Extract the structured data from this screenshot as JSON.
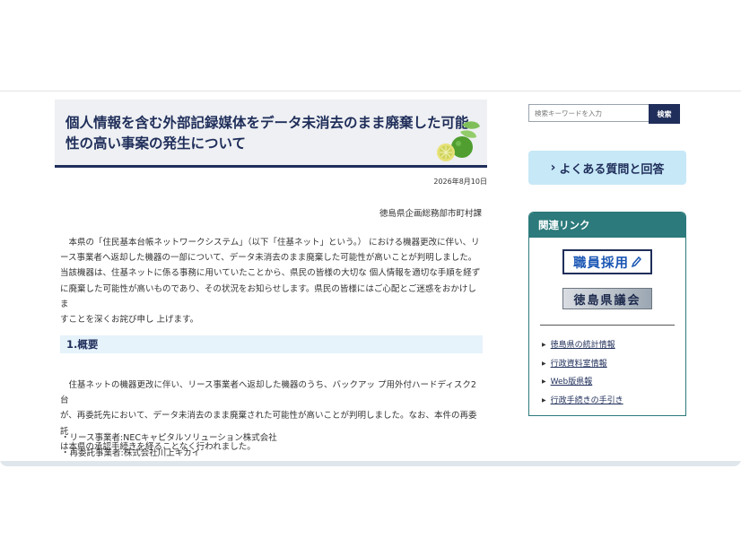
{
  "article": {
    "title": "個人情報を含む外部記録媒体をデータ未消去のまま廃棄した可能性の高い事案の発生について",
    "date": "2026年8月10日",
    "department": "徳島県企画総務部市町村課",
    "intro_lines": [
      "　本県の「住民基本台帳ネットワークシステム」（以下「住基ネット」という。） における機器更改に伴い、リ",
      "ース事業者へ返却した機器の一部について、データ未消去のまま廃棄した可能性が高いことが判明しました。",
      "当該機器は、住基ネットに係る事務に用いていたことから、県民の皆様の大切な 個人情報を適切な手順を経ず",
      "に廃棄した可能性が高いものであり、その状況をお知らせします。県民の皆様にはご心配とご迷惑をおかけしま",
      "すことを深くお詫び申し 上げます。"
    ],
    "section1": {
      "heading": "1.概要",
      "lines": [
        "　住基ネットの機器更改に伴い、リース事業者へ返却した機器のうち、バックアッ プ用外付ハードディスク2台",
        "が、再委託先において、データ未消去のまま廃棄された可能性が高いことが判明しました。なお、本件の再委託",
        "は本県の承認手続きを経ることなく行われました。"
      ],
      "bullets": [
        "・リース事業者:NECキャピタルソリューション株式会社",
        "・再委託事業者:株式会社川上キカイ"
      ]
    }
  },
  "sidebar": {
    "search_placeholder": "検索キーワードを入力",
    "search_button": "検索",
    "faq_label": "よくある質問と回答",
    "links_title": "関連リンク",
    "banner_recruit": "職員採用",
    "banner_assembly": "徳島県議会",
    "links": [
      "徳島県の統計情報",
      "行政資料室情報",
      "Web版県報",
      "行政手続きの手引き"
    ]
  },
  "colors": {
    "navy": "#1f2e5a",
    "teal": "#2c7a7b",
    "light_blue": "#c7e8f7",
    "section_bg": "#e6f3fb"
  }
}
